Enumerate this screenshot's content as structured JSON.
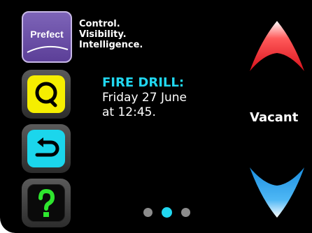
{
  "brand": {
    "logo_text": "Prefect",
    "tagline": [
      "Control.",
      "Visibility.",
      "Intelligence."
    ]
  },
  "notice": {
    "heading": "FIRE DRILL:",
    "line1": "Friday 27 June",
    "line2": "at 12:45."
  },
  "room": {
    "status": "Vacant"
  },
  "pagination": {
    "total": 3,
    "active_index": 1
  },
  "icons": {
    "search": "search-icon",
    "back": "back-icon",
    "help": "help-icon",
    "up": "up-arrow-icon",
    "down": "down-arrow-icon"
  },
  "colors": {
    "background": "#000000",
    "accent_cyan": "#21d7f0",
    "search_yellow": "#f5ee00",
    "help_green": "#2ee62e",
    "up_red": "#e0141c",
    "down_blue": "#1e9be6",
    "logo_purple": "#6a4fa8"
  }
}
